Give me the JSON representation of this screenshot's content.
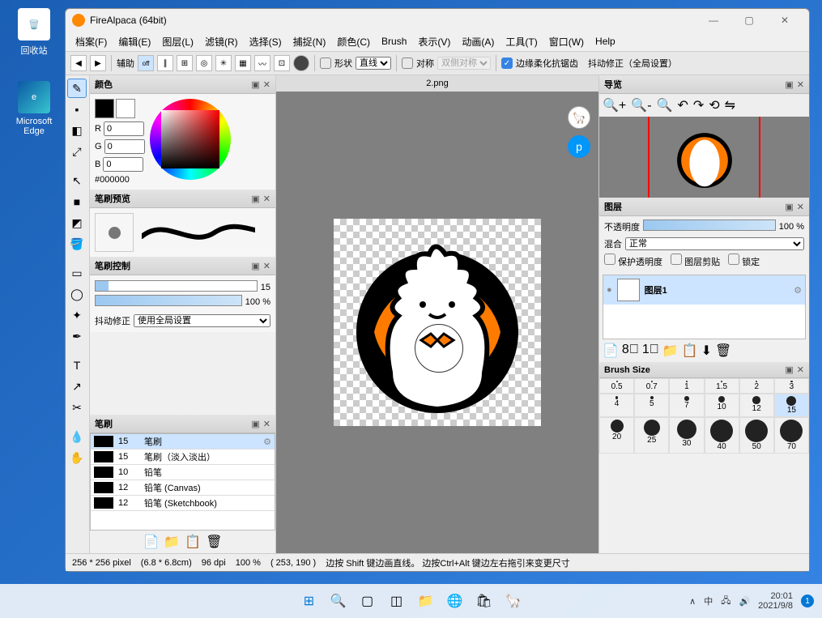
{
  "desktop": {
    "recycle": "回收站",
    "edge": "Microsoft Edge"
  },
  "app": {
    "title": "FireAlpaca (64bit)"
  },
  "menu": {
    "file": "档案(F)",
    "edit": "编辑(E)",
    "layer": "图层(L)",
    "filter": "滤镜(R)",
    "select": "选择(S)",
    "snap": "捕捉(N)",
    "color": "颜色(C)",
    "brush": "Brush",
    "view": "表示(V)",
    "animation": "动画(A)",
    "tool": "工具(T)",
    "window": "窗口(W)",
    "help": "Help"
  },
  "toolbar": {
    "assist": "辅助",
    "shape": "形状",
    "shape_mode": "直线",
    "symmetry": "对称",
    "sym_mode": "双侧对称",
    "aa": "边缘柔化抗锯齿",
    "shake": "抖动修正（全局设置）"
  },
  "canvas_tab": "2.png",
  "color": {
    "title": "颜色",
    "r": "0",
    "g": "0",
    "b": "0",
    "hex": "#000000"
  },
  "brush_preview": {
    "title": "笔刷预览"
  },
  "brush_ctrl": {
    "title": "笔刷控制",
    "size": "15",
    "opacity": "100 %",
    "shake": "抖动修正",
    "shake_mode": "使用全局设置"
  },
  "brush_panel": {
    "title": "笔刷",
    "items": [
      {
        "size": "15",
        "name": "笔刷",
        "sel": true
      },
      {
        "size": "15",
        "name": "笔刷（淡入淡出）"
      },
      {
        "size": "10",
        "name": "铅笔"
      },
      {
        "size": "12",
        "name": "铅笔 (Canvas)"
      },
      {
        "size": "12",
        "name": "铅笔 (Sketchbook)"
      }
    ]
  },
  "nav": {
    "title": "导览"
  },
  "layers": {
    "title": "图层",
    "opacity": "不透明度",
    "opacity_val": "100 %",
    "blend": "混合",
    "blend_mode": "正常",
    "ck_alpha": "保护透明度",
    "ck_clip": "图层剪贴",
    "ck_lock": "锁定",
    "layer1": "图层1"
  },
  "brushsize": {
    "title": "Brush Size",
    "vals": [
      "0.5",
      "0.7",
      "1",
      "1.5",
      "2",
      "3",
      "4",
      "5",
      "7",
      "10",
      "12",
      "15",
      "20",
      "25",
      "30",
      "40",
      "50",
      "70"
    ]
  },
  "status": {
    "dims": "256 * 256 pixel",
    "cm": "(6.8 * 6.8cm)",
    "dpi": "96 dpi",
    "zoom": "100 %",
    "pos": "( 253, 190 )",
    "hint": "边按 Shift 键边画直线。 边按Ctrl+Alt 键边左右拖引来变更尺寸"
  },
  "tray": {
    "lang1": "∧",
    "lang2": "中",
    "time": "20:01",
    "date": "2021/9/8"
  }
}
